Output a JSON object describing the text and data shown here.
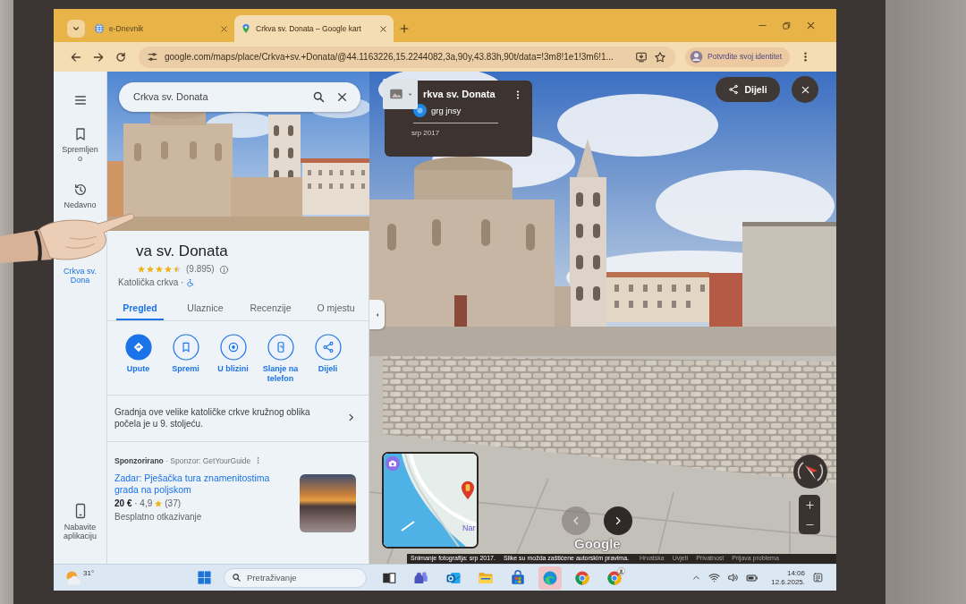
{
  "browser": {
    "tabs": [
      {
        "title": "e-Dnevnik",
        "kind": "globe",
        "selected": false
      },
      {
        "title": "Crkva sv. Donata – Google kart",
        "kind": "pin",
        "selected": true
      }
    ],
    "address": "google.com/maps/place/Crkva+sv.+Donata/@44.1163226,15.2244082,3a,90y,43.83h,90t/data=!3m8!1e1!3m6!1...",
    "profile_chip": "Potvrdite svoj identitet"
  },
  "rail": {
    "items": [
      {
        "kind": "saved",
        "label": "Spremljeno",
        "selected": false
      },
      {
        "kind": "recent",
        "label": "Nedavno",
        "selected": false
      },
      {
        "kind": "place",
        "label": "Crkva sv. Dona",
        "selected": true
      }
    ],
    "app_link": "Nabavite aplikaciju"
  },
  "place": {
    "search": {
      "value": "Crkva sv. Donata"
    },
    "title": "va sv. Donata",
    "stars": 4.5,
    "review_count": "(9.895)",
    "category": "Katolička crkva ·",
    "tabs": [
      {
        "label": "Pregled",
        "selected": true
      },
      {
        "label": "Ulaznice",
        "selected": false
      },
      {
        "label": "Recenzije",
        "selected": false
      },
      {
        "label": "O mjestu",
        "selected": false
      }
    ],
    "actions": [
      {
        "kind": "directions",
        "label": "Upute",
        "primary": true
      },
      {
        "kind": "save",
        "label": "Spremi",
        "primary": false
      },
      {
        "kind": "nearby",
        "label": "U blizini",
        "primary": false
      },
      {
        "kind": "send",
        "label": "Slanje na telefon",
        "primary": false
      },
      {
        "kind": "share",
        "label": "Dijeli",
        "primary": false
      }
    ],
    "description": "Gradnja ove velike katoličke crkve kružnog oblika počela je u 9. stoljeću.",
    "sponsored": {
      "header": "**Sponzorirano** · Sponzor: GetYourGuide",
      "title": "Zadar: Pješačka tura znamenitostima grada na poljskom",
      "price_line": "**20 €** · 4,9",
      "reviews": "(37)",
      "note": "Besplatno otkazivanje"
    }
  },
  "street_view": {
    "card": {
      "title": "rkva sv. Donata",
      "author": "grg jnsy",
      "date": "srp 2017"
    },
    "share": "Dijeli",
    "minimap_label": "Nar",
    "arrows": [
      {
        "kind": "prev",
        "disabled": true
      },
      {
        "kind": "next",
        "disabled": false
      }
    ],
    "logo": "Google",
    "footer": [
      {
        "text": "Snimanje fotografija: srp 2017.",
        "kind": "note"
      },
      {
        "text": "Slike su možda zaštićene autorskim pravima.",
        "kind": "note"
      },
      {
        "text": "Hrvatska",
        "kind": "link"
      },
      {
        "text": "Uvjeti",
        "kind": "link"
      },
      {
        "text": "Privatnost",
        "kind": "link"
      },
      {
        "text": "Prijava problema",
        "kind": "link"
      }
    ]
  },
  "taskbar": {
    "weather": "31°",
    "search_placeholder": "Pretraživanje",
    "apps": [
      {
        "kind": "taskview",
        "selected": false,
        "badge": false
      },
      {
        "kind": "people",
        "selected": false,
        "badge": false
      },
      {
        "kind": "mail",
        "selected": false,
        "badge": false
      },
      {
        "kind": "folder",
        "selected": false,
        "badge": false
      },
      {
        "kind": "bag",
        "selected": false,
        "badge": false
      },
      {
        "kind": "swirl",
        "selected": true,
        "badge": false
      },
      {
        "kind": "tricolor",
        "selected": false,
        "badge": false
      },
      {
        "kind": "tricolor",
        "selected": false,
        "badge": true
      }
    ],
    "time": "14:06",
    "date": "12.6.2025."
  }
}
